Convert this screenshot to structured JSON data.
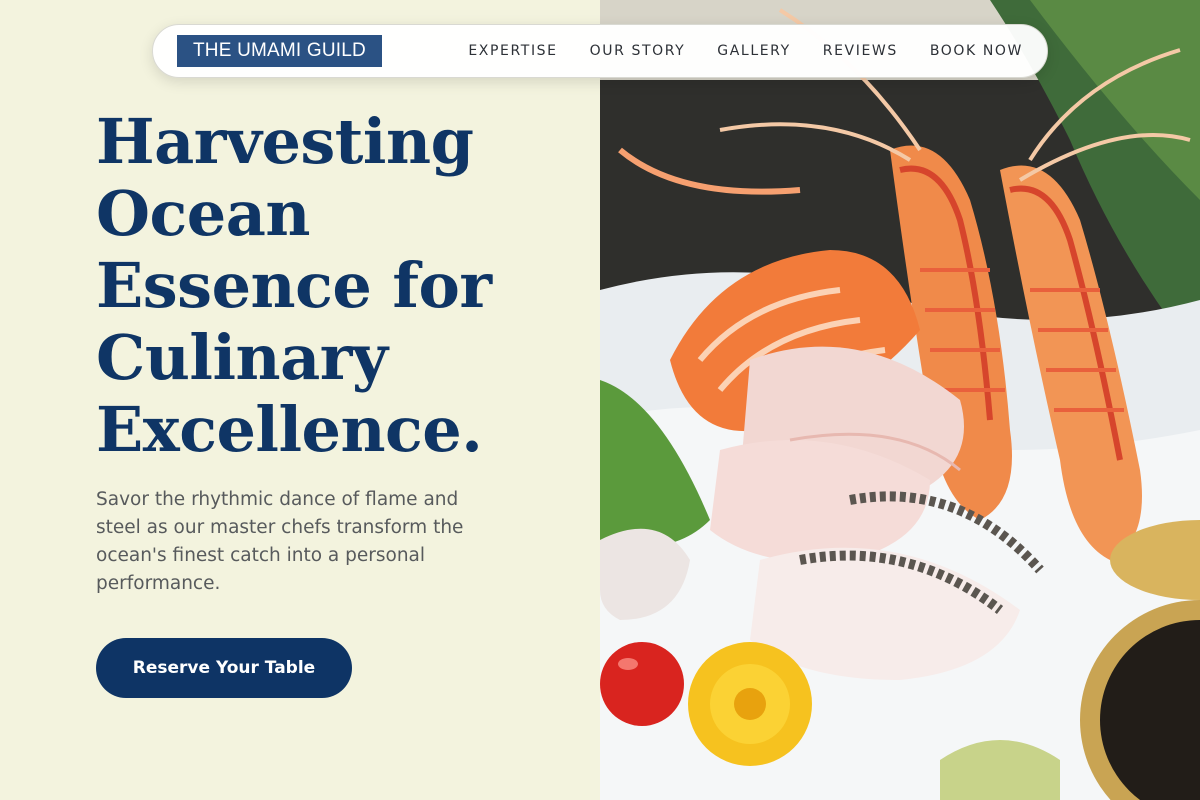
{
  "nav": {
    "brand": "THE UMAMI GUILD",
    "links": [
      "EXPERTISE",
      "OUR STORY",
      "GALLERY",
      "REVIEWS",
      "BOOK NOW"
    ]
  },
  "hero": {
    "title_lines": [
      "Harvesting",
      "Ocean",
      "Essence for",
      "Culinary",
      "Excellence."
    ],
    "subtitle": "Savor the rhythmic dance of flame and steel as our master chefs transform the ocean's finest catch into a personal performance.",
    "cta_label": "Reserve Your Table",
    "image_alt": "sashimi-platter-photo"
  },
  "colors": {
    "background": "#f3f3de",
    "brand_bg": "#2b5284",
    "headline": "#0f3565",
    "cta_bg": "#0e3465",
    "body_text": "#575a5c"
  }
}
